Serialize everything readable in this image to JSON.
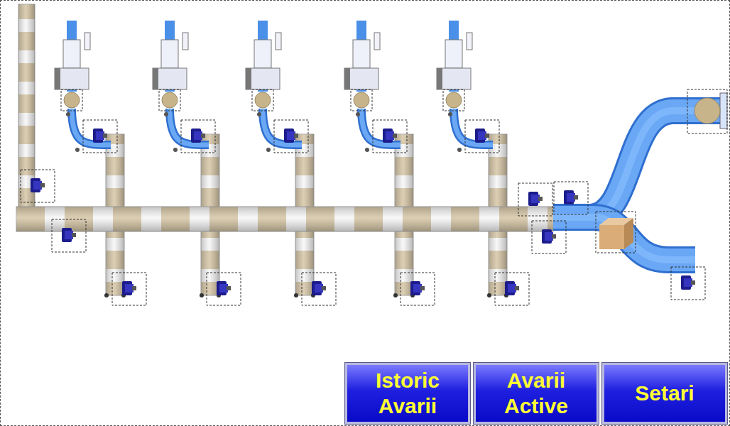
{
  "buttons": [
    {
      "label": "Istoric Avarii"
    },
    {
      "label": "Avarii Active"
    },
    {
      "label": "Setari"
    }
  ]
}
